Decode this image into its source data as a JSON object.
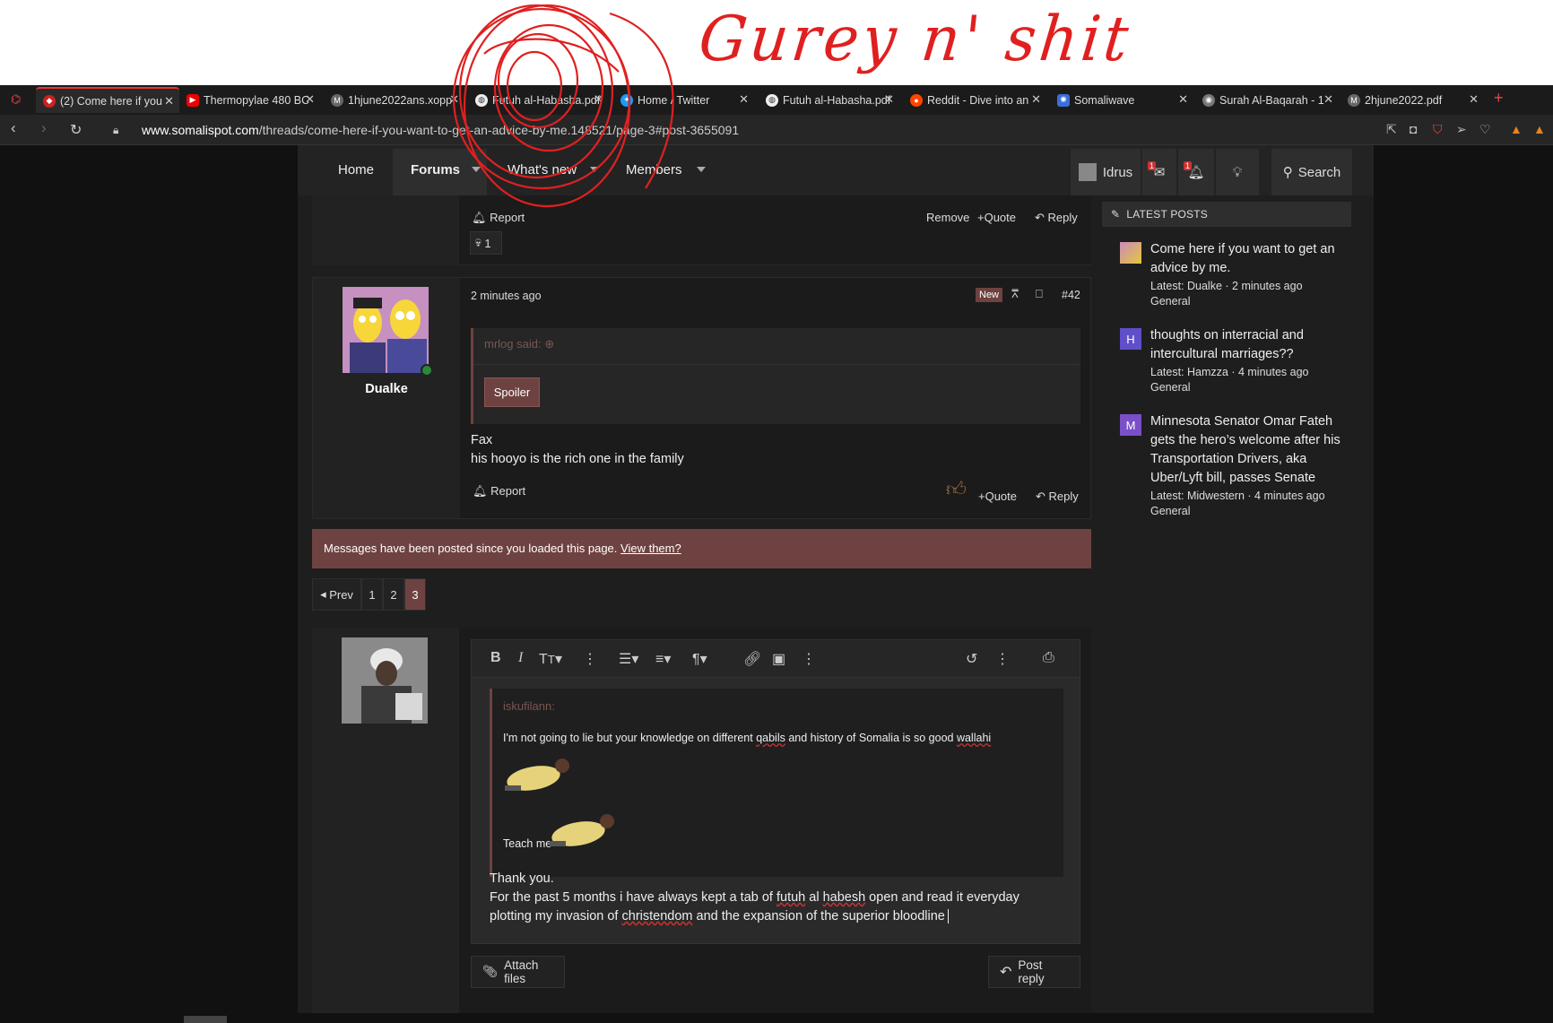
{
  "annotation": {
    "text": "Gurey n' shit"
  },
  "tabs": [
    {
      "label": "(2) Come here if you",
      "active": true
    },
    {
      "label": "Thermopylae 480 BC"
    },
    {
      "label": "1hjune2022ans.xopp"
    },
    {
      "label": "Futuh al-Habasha.pdf"
    },
    {
      "label": "Home / Twitter"
    },
    {
      "label": "Futuh al-Habasha.pdf"
    },
    {
      "label": "Reddit - Dive into an"
    },
    {
      "label": "Somaliwave"
    },
    {
      "label": "Surah Al-Baqarah - 1"
    },
    {
      "label": "2hjune2022.pdf"
    }
  ],
  "address": {
    "host": "www.somalispot.com",
    "path": "/threads/come-here-if-you-want-to-get-an-advice-by-me.148521/page-3#post-3655091"
  },
  "nav": {
    "home": "Home",
    "forums": "Forums",
    "whats_new": "What's new",
    "members": "Members",
    "user": "Idrus",
    "msg_badge": "1",
    "alert_badge": "1",
    "search": "Search"
  },
  "postA": {
    "report": "Report",
    "remove": "Remove",
    "quote": "Quote",
    "reply": "Reply",
    "reaction_count": "1"
  },
  "postB": {
    "username": "Dualke",
    "time": "2 minutes ago",
    "new_badge": "New",
    "post_num": "#42",
    "quote_author": "mrlog said:",
    "spoiler": "Spoiler",
    "line1": "Fax",
    "line2": "his hooyo is the rich one in the family",
    "report": "Report",
    "quote": "Quote",
    "reply": "Reply"
  },
  "notice": {
    "text": "Messages have been posted since you loaded this page.",
    "link": "View them?"
  },
  "pager": {
    "prev": "Prev",
    "pages": [
      "1",
      "2",
      "3"
    ],
    "current": "3"
  },
  "editor": {
    "quote_author": "iskufilann:",
    "quote_pre": "I'm not going to lie but your knowledge on different ",
    "quote_w1": "qabils",
    "quote_mid": " and history of Somalia is so good ",
    "quote_w2": "wallahi",
    "quote_teach": "Teach me",
    "line1": "Thank you.",
    "line2_a": "For the past 5 months i have always kept a tab of ",
    "line2_w1": "futuh",
    "line2_b": " al ",
    "line2_w2": "habesh",
    "line2_c": " open and read it everyday",
    "line3_a": "plotting my invasion of ",
    "line3_w1": "christendom",
    "line3_b": " and the expansion of the superior bloodline",
    "attach": "Attach files",
    "post_reply": "Post reply"
  },
  "sidebar": {
    "heading": "Latest posts",
    "posts": [
      {
        "title": "Come here if you want to get an advice by me.",
        "meta": "Latest: Dualke · 2 minutes ago",
        "forum": "General",
        "avatar_letter": ""
      },
      {
        "title": "thoughts on interracial and intercultural marriages??",
        "meta": "Latest: Hamzza · 4 minutes ago",
        "forum": "General",
        "avatar_letter": "H"
      },
      {
        "title": "Minnesota Senator Omar Fateh gets the hero’s welcome after his Transportation Drivers, aka Uber/Lyft bill, passes Senate",
        "meta": "Latest: Midwestern · 4 minutes ago",
        "forum": "General",
        "avatar_letter": "M"
      }
    ]
  },
  "colors": {
    "accent": "#6e4240",
    "annotation": "#e02020",
    "tab_active": "#e33333"
  }
}
